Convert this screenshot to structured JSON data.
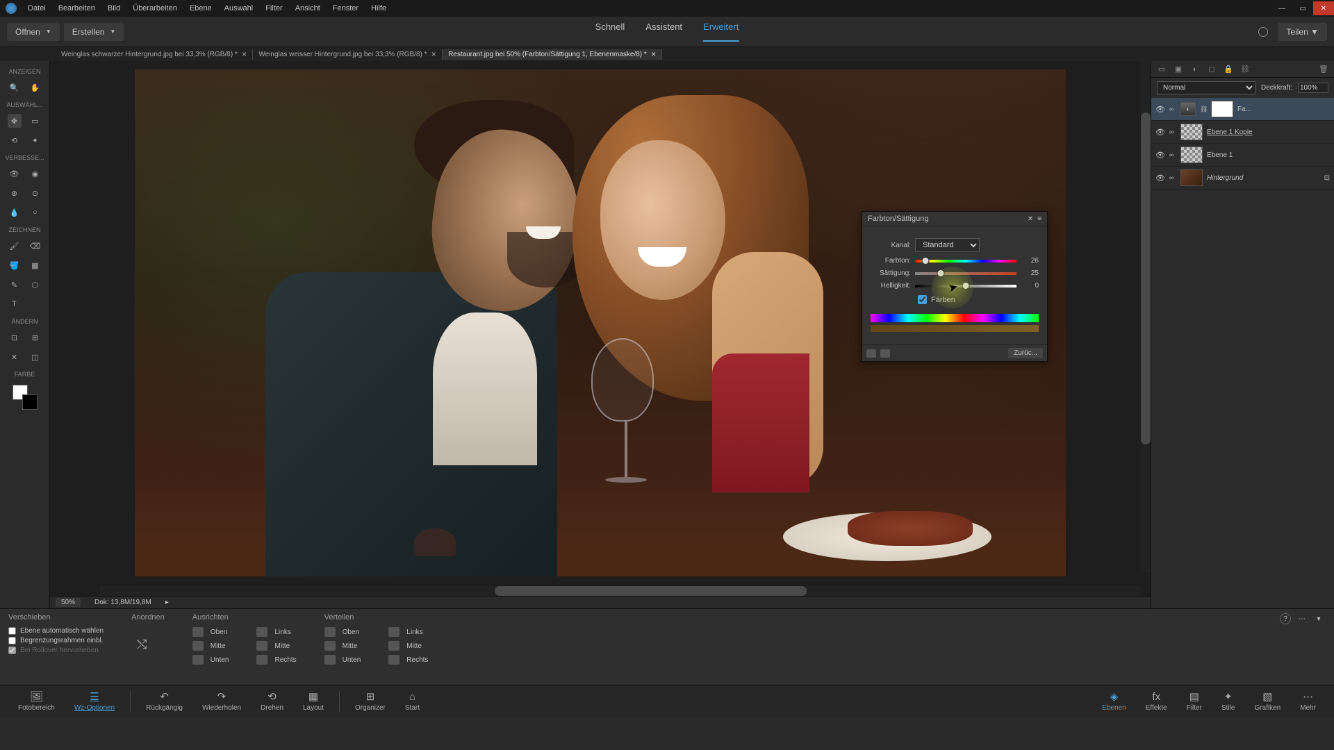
{
  "menus": [
    "Datei",
    "Bearbeiten",
    "Bild",
    "Überarbeiten",
    "Ebene",
    "Auswahl",
    "Filter",
    "Ansicht",
    "Fenster",
    "Hilfe"
  ],
  "topbar": {
    "open": "Öffnen",
    "create": "Erstellen",
    "share": "Teilen"
  },
  "modes": {
    "quick": "Schnell",
    "guided": "Assistent",
    "expert": "Erweitert"
  },
  "tabs": [
    {
      "label": "Weinglas schwarzer Hintergrund.jpg bei 33,3% (RGB/8) *",
      "active": false
    },
    {
      "label": "Weinglas weisser Hintergrund.jpg bei 33,3% (RGB/8) *",
      "active": false
    },
    {
      "label": "Restaurant.jpg bei 50% (Farbton/Sättigung 1, Ebenenmaske/8) *",
      "active": true
    }
  ],
  "leftbar": {
    "view": "ANZEIGEN",
    "select": "AUSWÄHL...",
    "enhance": "VERBESSE...",
    "draw": "ZEICHNEN",
    "modify": "ÄNDERN",
    "color": "FARBE"
  },
  "adjustment": {
    "title": "Farbton/Sättigung",
    "channel_label": "Kanal:",
    "channel_value": "Standard",
    "hue_label": "Farbton:",
    "hue_value": "26",
    "sat_label": "Sättigung:",
    "sat_value": "25",
    "lig_label": "Helligkeit:",
    "lig_value": "0",
    "colorize": "Färben",
    "reset": "Zurüc..."
  },
  "status": {
    "zoom": "50%",
    "doc": "Dok: 13,8M/19,8M"
  },
  "layers": {
    "blend_mode": "Normal",
    "opacity_label": "Deckkraft:",
    "opacity_value": "100%",
    "items": [
      {
        "name": "Fa...",
        "type": "adjustment"
      },
      {
        "name": "Ebene 1 Kopie",
        "type": "normal"
      },
      {
        "name": "Ebene 1",
        "type": "normal"
      },
      {
        "name": "Hintergrund",
        "type": "background"
      }
    ]
  },
  "options": {
    "tool": "Verschieben",
    "arrange": "Anordnen",
    "align": "Ausrichten",
    "distribute": "Verteilen",
    "auto_select": "Ebene automatisch wählen",
    "bounding": "Begrenzungsrahmen einbl.",
    "rollover": "Bei Rollover hervorheben",
    "top": "Oben",
    "middle": "Mitte",
    "bottom": "Unten",
    "left": "Links",
    "right": "Rechts"
  },
  "bottom": {
    "photobin": "Fotobereich",
    "tooloptions": "Wz-Optionen",
    "undo": "Rückgängig",
    "redo": "Wiederholen",
    "rotate": "Drehen",
    "layout": "Layout",
    "organizer": "Organizer",
    "home": "Start",
    "layers": "Ebenen",
    "effects": "Effekte",
    "filters": "Filter",
    "styles": "Stile",
    "graphics": "Grafiken",
    "more": "Mehr"
  }
}
